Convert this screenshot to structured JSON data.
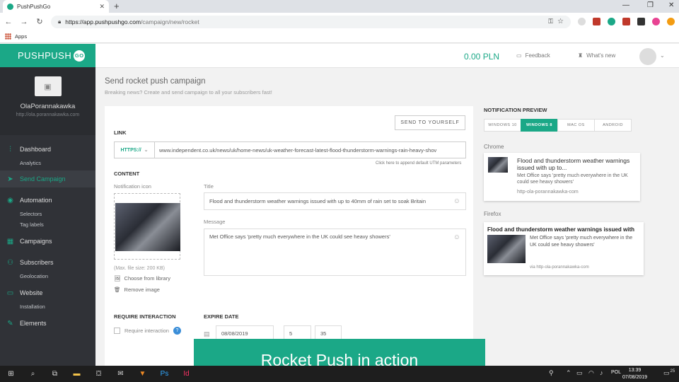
{
  "browser": {
    "tab_title": "PushPushGo",
    "url_domain": "https://app.pushpushgo.com",
    "url_path": "/campaign/new/rocket",
    "bookmarks_label": "Apps"
  },
  "sidebar": {
    "brand": "PUSHPUSH",
    "brand_badge": "GO",
    "org_name": "OlaPorannakawka",
    "org_url": "http://ola.porannakawka.com",
    "items": [
      {
        "label": "Dashboard",
        "icon": "chart-icon"
      },
      {
        "label": "Analytics",
        "sub": true
      },
      {
        "label": "Send Campaign",
        "icon": "paper-plane-icon",
        "active": true
      },
      {
        "label": "Automation",
        "icon": "automation-icon"
      },
      {
        "label": "Selectors",
        "sub": true
      },
      {
        "label": "Tag labels",
        "sub": true
      },
      {
        "label": "Campaigns",
        "icon": "grid-icon"
      },
      {
        "label": "Subscribers",
        "icon": "users-icon"
      },
      {
        "label": "Geolocation",
        "sub": true
      },
      {
        "label": "Website",
        "icon": "website-icon"
      },
      {
        "label": "Installation",
        "sub": true
      },
      {
        "label": "Elements",
        "icon": "pencil-icon"
      }
    ]
  },
  "topbar": {
    "balance": "0.00 PLN",
    "feedback": "Feedback",
    "whats_new": "What's new"
  },
  "page": {
    "title": "Send rocket push campaign",
    "subtitle": "Breaking news? Create and send campaign to all your subscribers fast!"
  },
  "form": {
    "send_to_yourself": "SEND TO YOURSELF",
    "link_label": "LINK",
    "protocol": "HTTPS://",
    "link_value": "www.independent.co.uk/news/uk/home-news/uk-weather-forecast-latest-flood-thunderstorm-warnings-rain-heavy-shov",
    "utm_hint": "Click here to append default UTM parameters",
    "content_label": "CONTENT",
    "notification_icon_label": "Notification icon",
    "file_size_hint": "(Max. file size: 200 KB)",
    "choose_library": "Choose from library",
    "remove_image": "Remove image",
    "title_label": "Title",
    "title_value": "Flood and thunderstorm weather warnings issued with up to 40mm of rain set to soak Britain",
    "message_label": "Message",
    "message_value": "Met Office says 'pretty much everywhere in the UK could see heavy showers'",
    "require_interaction_label": "REQUIRE INTERACTION",
    "require_interaction_checkbox": "Require interaction",
    "help_badge": "?",
    "expire_date_label": "EXPIRE DATE",
    "expire_date": "08/08/2019",
    "expire_hour": "5",
    "expire_minute": "35"
  },
  "preview": {
    "label": "NOTIFICATION PREVIEW",
    "tabs": [
      "WINDOWS 10",
      "WINDOWS 8",
      "MAC OS",
      "ANDROID"
    ],
    "active_tab": "WINDOWS 8",
    "chrome": {
      "browser": "Chrome",
      "title": "Flood and thunderstorm weather warnings issued with up to...",
      "message": "Met Office says 'pretty much everywhere in the UK could see heavy showers'",
      "site": "http-ola-porannakawka-com"
    },
    "firefox": {
      "browser": "Firefox",
      "title": "Flood and thunderstorm weather warnings issued with",
      "message": "Met Office says 'pretty much everywhere in the UK could see heavy showers'",
      "site": "via http-ola-porannakawka-com"
    }
  },
  "overlay": {
    "caption": "Rocket Push in action"
  },
  "taskbar": {
    "lang": "POL",
    "time": "13:39",
    "date": "07/08/2019",
    "badge": "25"
  },
  "colors": {
    "accent": "#1ba887",
    "sidebar": "#303237"
  }
}
